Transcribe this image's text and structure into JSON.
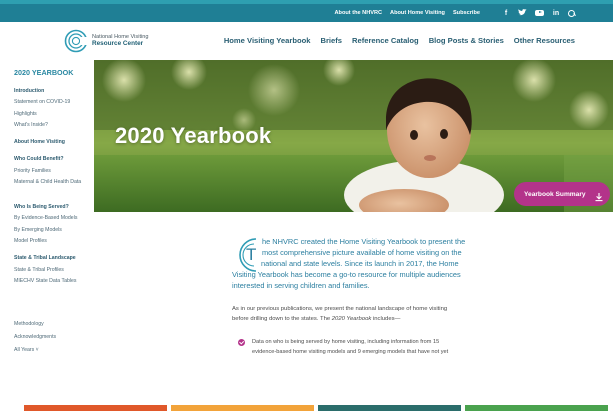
{
  "top_bar": {
    "links": [
      "About the NHVRC",
      "About Home Visiting",
      "Subscribe"
    ],
    "social": [
      "facebook-icon",
      "twitter-icon",
      "youtube-icon",
      "linkedin-icon"
    ],
    "search_icon": "search-icon",
    "social_glyphs": {
      "facebook": "f",
      "linkedin": "in"
    }
  },
  "header": {
    "logo": {
      "line1": "National Home Visiting",
      "line2": "Resource Center"
    },
    "nav": [
      "Home Visiting Yearbook",
      "Briefs",
      "Reference Catalog",
      "Blog Posts & Stories",
      "Other Resources"
    ]
  },
  "sidebar": {
    "title": "2020 YEARBOOK",
    "items": [
      {
        "label": "Introduction",
        "head": true
      },
      {
        "label": "Statement on COVID-19"
      },
      {
        "label": "Highlights"
      },
      {
        "label": "What's Inside?"
      },
      {
        "label": "About Home Visiting",
        "head": true
      },
      {
        "label": "Who Could Benefit?",
        "head": true
      },
      {
        "label": "Priority Families"
      },
      {
        "label": "Maternal & Child Health Data"
      },
      {
        "label": "Who Is Being Served?",
        "head": true
      },
      {
        "label": "By Evidence-Based Models"
      },
      {
        "label": "By Emerging Models"
      },
      {
        "label": "Model Profiles"
      },
      {
        "label": "State & Tribal Landscape",
        "head": true
      },
      {
        "label": "State & Tribal Profiles"
      },
      {
        "label": "MIECHV State Data Tables"
      },
      {
        "label": "Methodology"
      },
      {
        "label": "Acknowledgments"
      },
      {
        "label": "All Years ˅"
      }
    ]
  },
  "hero": {
    "title": "2020 Yearbook",
    "button_label": "Yearbook Summary"
  },
  "content": {
    "dropcap": "T",
    "intro_lines": [
      "he NHVRC created the Home Visiting Yearbook to present the",
      "most comprehensive picture available of home visiting on the",
      "national and state levels. Since its launch in 2017, the Home",
      "Visiting Yearbook has become a go-to resource for multiple audiences",
      "interested in serving children and families."
    ],
    "para2_line1": "As in our previous publications, we present the national landscape of home visiting",
    "para2_line2_prefix": "before drilling down to the states. The ",
    "para2_line2_em": "2020 Yearbook",
    "para2_line2_suffix": " includes—",
    "bullet_lines": [
      "Data on who is being served by home visiting, including information from 15",
      "evidence-based home visiting models and 9 emerging models that have not yet"
    ]
  },
  "colors": {
    "top_bar": "#1f7f95",
    "accent": "#2c7fa0",
    "magenta": "#b3338a",
    "footer": [
      "#e0582a",
      "#f2a33a",
      "#2b6d6b",
      "#4aa24e"
    ]
  }
}
